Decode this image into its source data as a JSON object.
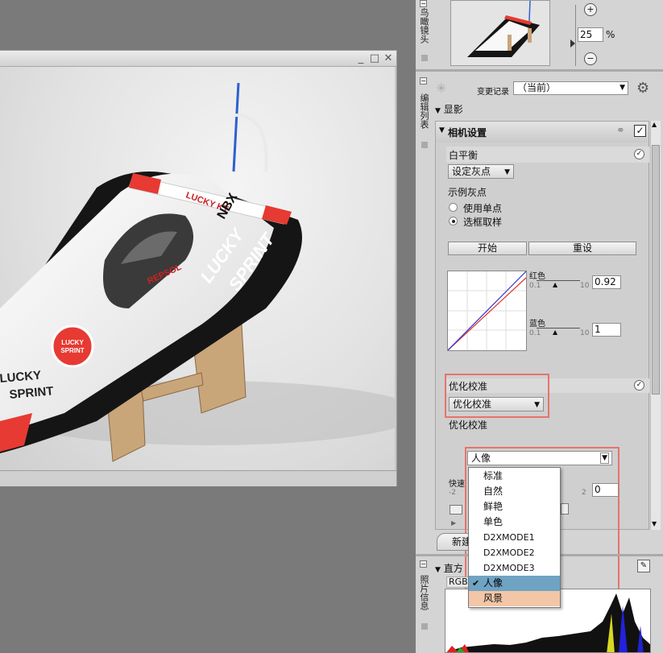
{
  "image_window": {
    "controls": {
      "minimize": "_",
      "maximize": "□",
      "close": "✕"
    }
  },
  "photo": {
    "wing_text": "LUCKY KT",
    "hull_text1": "LUCKY",
    "hull_text2": "SPRINT",
    "badge_line1": "LUCKY",
    "badge_line2": "SPRINT",
    "side_text1": "LUCKY",
    "side_text2": "SPRINT",
    "nbx": "NBX",
    "repsol": "REPSOL"
  },
  "birdseye": {
    "label": "鸟瞰镜头",
    "zoom_value": "25",
    "zoom_unit": "%"
  },
  "edit_list": {
    "label": "编辑列表",
    "history_label": "变更记录",
    "history_value": "（当前）",
    "section_title": "显影",
    "camera_settings": "相机设置",
    "white_balance": "白平衡",
    "set_gray_dropdown": "设定灰点",
    "sample_gray": "示例灰点",
    "radio_single": "使用单点",
    "radio_box": "选框取样",
    "start_button": "开始",
    "reset_button": "重设",
    "red_label": "红色",
    "red_min": "0.1",
    "red_max": "10",
    "red_value": "0.92",
    "blue_label": "蓝色",
    "blue_min": "0.1",
    "blue_max": "10",
    "blue_value": "1",
    "picture_control_label": "优化校准",
    "picture_control_dropdown": "优化校准",
    "picture_control_sub": "优化校准",
    "preset_dropdown": "人像",
    "quick_label": "快速",
    "quick_min": "-2",
    "quick_max": "2",
    "quick_value": "0",
    "new_button": "新建"
  },
  "preset_options": [
    {
      "label": "标准",
      "selected": false
    },
    {
      "label": "自然",
      "selected": false
    },
    {
      "label": "鲜艳",
      "selected": false
    },
    {
      "label": "单色",
      "selected": false
    },
    {
      "label": "D2XMODE1",
      "selected": false
    },
    {
      "label": "D2XMODE2",
      "selected": false
    },
    {
      "label": "D2XMODE3",
      "selected": false
    },
    {
      "label": "人像",
      "selected": true
    },
    {
      "label": "风景",
      "selected": false
    }
  ],
  "photo_info": {
    "label": "照片信息",
    "histogram_title": "直方",
    "channel": "RGB"
  },
  "colors": {
    "highlight": "#e8736b",
    "selected_bg": "#6fa3c3",
    "hover_bg": "#f2c6a6"
  }
}
